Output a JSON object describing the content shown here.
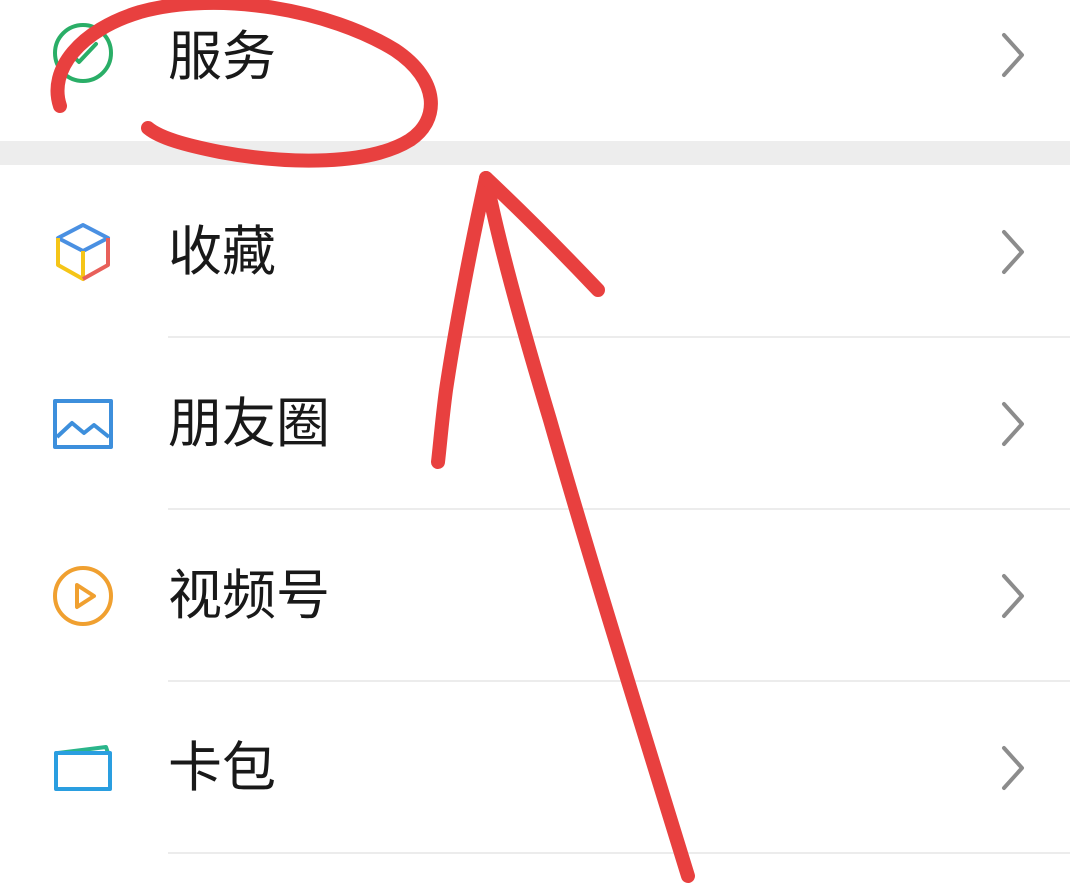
{
  "menu": {
    "items": [
      {
        "key": "services",
        "label": "服务",
        "icon": "services-check-circle-icon",
        "color": "#2aae67"
      },
      {
        "key": "favorites",
        "label": "收藏",
        "icon": "cube-icon",
        "color": "#4a90e2"
      },
      {
        "key": "moments",
        "label": "朋友圈",
        "icon": "image-icon",
        "color": "#3d8fdc"
      },
      {
        "key": "channels",
        "label": "视频号",
        "icon": "play-circle-icon",
        "color": "#f0a030"
      },
      {
        "key": "cards",
        "label": "卡包",
        "icon": "card-wallet-icon",
        "color": "#2a9ee0"
      }
    ]
  },
  "annotation": {
    "color": "#e8403f",
    "shapes": [
      "ellipse-around-services",
      "arrow-pointing-up-to-services"
    ]
  }
}
